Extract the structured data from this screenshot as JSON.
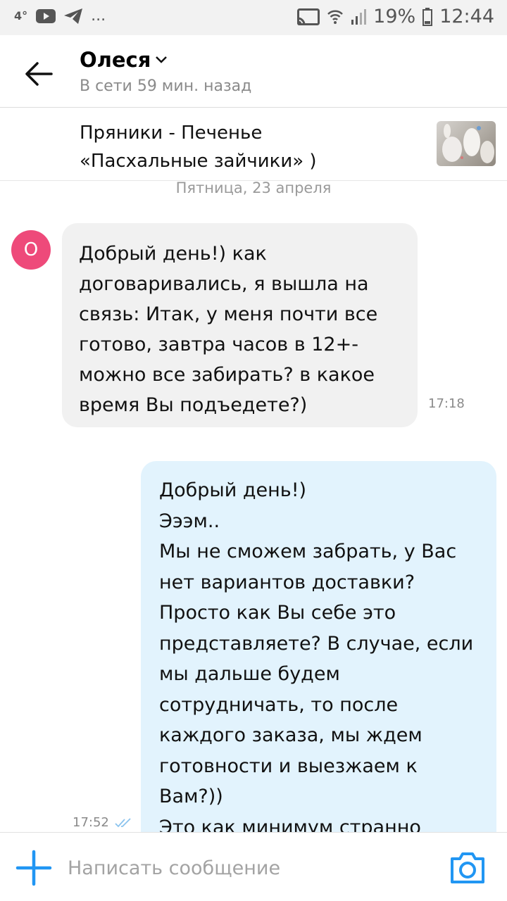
{
  "status_bar": {
    "temperature": "4°",
    "more": "...",
    "battery": "19%",
    "time": "12:44",
    "icons": [
      "youtube-icon",
      "telegram-icon",
      "cast-icon",
      "wifi-icon",
      "signal-icon",
      "battery-icon"
    ]
  },
  "header": {
    "name": "Олеся",
    "status": "В сети 59 мин. назад"
  },
  "product": {
    "title_line1": "Пряники - Печенье",
    "title_line2": "«Пасхальные зайчики» )"
  },
  "chat": {
    "date": "Пятница, 23 апреля",
    "avatar_letter": "О",
    "messages": [
      {
        "direction": "incoming",
        "text": "Добрый день!) как договаривались, я вышла на связь: Итак, у меня почти все готово, завтра часов в 12+- можно все забирать? в какое время Вы подъедете?)",
        "time": "17:18"
      },
      {
        "direction": "outgoing",
        "text": "Добрый день!)\nЭээм..\nМы не сможем забрать, у Вас нет вариантов доставки?\nПросто как Вы себе это представляете? В случае, если мы дальше будем сотрудничать, то после каждого заказа, мы ждем готовности и выезжаем к Вам?))\nЭто как минимум странно",
        "time": "17:52"
      }
    ]
  },
  "composer": {
    "placeholder": "Написать сообщение"
  },
  "colors": {
    "accent": "#2196f3",
    "avatar": "#ee4a7a",
    "incoming_bubble": "#f1f1f1",
    "outgoing_bubble": "#e2f3fd"
  }
}
